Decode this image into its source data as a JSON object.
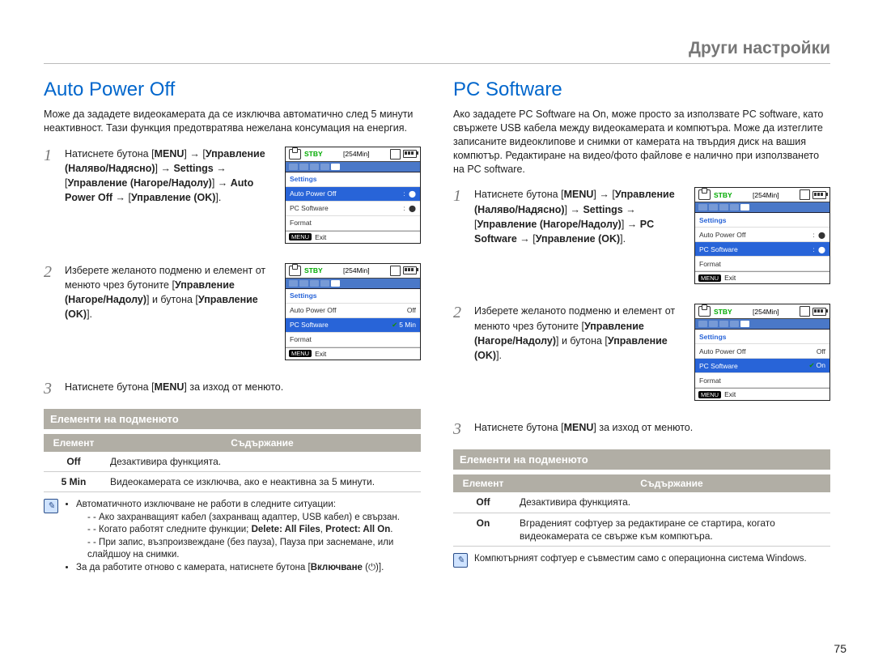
{
  "header": {
    "title": "Други настройки"
  },
  "pagenum": "75",
  "left": {
    "title": "Auto Power Off",
    "intro": "Може да зададете видеокамерата да се изключва автоматично след 5 минути неактивност. Тази функция предотвратява нежелана консумация на енергия.",
    "steps": [
      {
        "num": "1",
        "html": "Натиснете бутона [<b>MENU</b>] → [<b>Управление (Наляво/Надясно)</b>] → <b>Settings</b> → [<b>Управление (Нагоре/Надолу)</b>] → <b>Auto Power Off</b> → [<b>Управление (OK)</b>]."
      },
      {
        "num": "2",
        "html": "Изберете желаното подменю и елемент от менюто чрез бутоните [<b>Управление (Нагоре/Надолу)</b>] и бутона [<b>Управление (OK)</b>]."
      },
      {
        "num": "3",
        "html": "Натиснете бутона [<b>MENU</b>] за изход от менюто."
      }
    ],
    "submenu_head": "Елементи на подменюто",
    "table": {
      "cols": [
        "Елемент",
        "Съдържание"
      ],
      "rows": [
        {
          "k": "Off",
          "v": "Дезактивира функцията."
        },
        {
          "k": "5 Min",
          "v": "Видеокамерата се изключва, ако е неактивна за 5 минути."
        }
      ]
    },
    "note": {
      "paras": [
        "Автоматичното изключване не работи в следните ситуации:",
        "- Ако захранващият кабел (захранващ адаптер, USB кабел) е свързан.",
        "- Когато работят следните функции; <b>Delete: All Files</b>, <b>Protect: All On</b>.",
        "- При запис, възпроизвеждане (без пауза), Пауза при заснемане, или слайдшоу на снимки.",
        "За да работите отново с камерата, натиснете бутона [<b>Включване</b> (⏻)]."
      ]
    },
    "figs": [
      {
        "stby": "STBY",
        "time": "[254Min]",
        "header": "Settings",
        "rows": [
          {
            "label": "Auto Power Off",
            "selected": true,
            "dot": true
          },
          {
            "label": "PC Software",
            "dot": true
          },
          {
            "label": "Format"
          }
        ],
        "exit": "Exit"
      },
      {
        "stby": "STBY",
        "time": "[254Min]",
        "header": "Settings",
        "rows": [
          {
            "label": "Auto Power Off",
            "val": "Off"
          },
          {
            "label": "PC Software",
            "val": "5 Min",
            "selected": true,
            "check": true
          },
          {
            "label": "Format"
          }
        ],
        "exit": "Exit"
      }
    ]
  },
  "right": {
    "title": "PC Software",
    "intro": "Ако зададете PC Software на On, може просто за използвате PC software, като свържете USB кабела между видеокамерата и компютъра. Може да изтеглите записаните видеоклипове и снимки от камерата на твърдия диск на вашия компютър. Редактиране на видео/фото файлове е налично при използването на PC software.",
    "steps": [
      {
        "num": "1",
        "html": "Натиснете бутона [<b>MENU</b>] → [<b>Управление (Наляво/Надясно)</b>] → <b>Settings</b> → [<b>Управление (Нагоре/Надолу)</b>] → <b>PC Software</b> → [<b>Управление (OK)</b>]."
      },
      {
        "num": "2",
        "html": "Изберете желаното подменю и елемент от менюто чрез бутоните [<b>Управление (Нагоре/Надолу)</b>] и бутона [<b>Управление (OK)</b>]."
      },
      {
        "num": "3",
        "html": "Натиснете бутона [<b>MENU</b>] за изход от менюто."
      }
    ],
    "submenu_head": "Елементи на подменюто",
    "table": {
      "cols": [
        "Елемент",
        "Съдържание"
      ],
      "rows": [
        {
          "k": "Off",
          "v": "Дезактивира функцията."
        },
        {
          "k": "On",
          "v": "Вграденият софтуер за редактиране се стартира, когато видеокамерата се свърже към компютъра."
        }
      ]
    },
    "note": {
      "text": "Компютърният софтуер е съвместим само с операционна система Windows."
    },
    "figs": [
      {
        "stby": "STBY",
        "time": "[254Min]",
        "header": "Settings",
        "rows": [
          {
            "label": "Auto Power Off",
            "dot": true
          },
          {
            "label": "PC Software",
            "selected": true,
            "dot": true
          },
          {
            "label": "Format"
          }
        ],
        "exit": "Exit"
      },
      {
        "stby": "STBY",
        "time": "[254Min]",
        "header": "Settings",
        "rows": [
          {
            "label": "Auto Power Off",
            "val": "Off"
          },
          {
            "label": "PC Software",
            "val": "On",
            "selected": true,
            "check": true
          },
          {
            "label": "Format"
          }
        ],
        "exit": "Exit"
      }
    ]
  }
}
